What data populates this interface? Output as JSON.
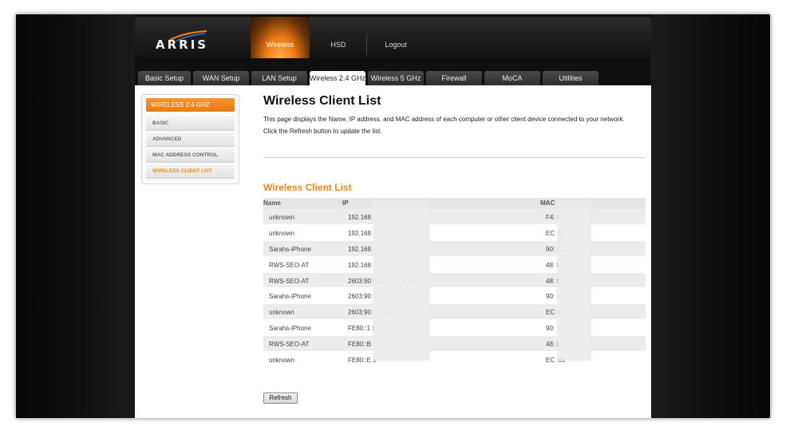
{
  "brand": {
    "logo_text": "ARRIS"
  },
  "nav": [
    {
      "label": "Wireless"
    },
    {
      "label": "HSD"
    },
    {
      "label": "Logout"
    }
  ],
  "tabs": [
    {
      "label": "Basic Setup"
    },
    {
      "label": "WAN Setup"
    },
    {
      "label": "LAN Setup"
    },
    {
      "label": "Wireless 2.4 GHz"
    },
    {
      "label": "Wireless 5 GHz"
    },
    {
      "label": "Firewall"
    },
    {
      "label": "MoCA"
    },
    {
      "label": "Utilities"
    }
  ],
  "sidebar": {
    "header": "WIRELESS 2.4 GHZ",
    "items": [
      {
        "label": "BASIC"
      },
      {
        "label": "ADVANCED"
      },
      {
        "label": "MAC ADDRESS CONTROL"
      },
      {
        "label": "WIRELESS CLIENT LIST"
      }
    ]
  },
  "page": {
    "title": "Wireless Client List",
    "desc1": "This page displays the Name, IP address, and MAC address of each computer or other client device connected to your network.",
    "desc2": "Click the Refresh button to update the list.",
    "subtitle": "Wireless Client List"
  },
  "table": {
    "headers": {
      "name": "Name",
      "ip": "IP",
      "mac": "MAC"
    },
    "rows": [
      {
        "name": "unknown",
        "ip": "192.168",
        "mac": "F4:                     8F"
      },
      {
        "name": "unknown",
        "ip": "192.168",
        "mac": "EC                     :66"
      },
      {
        "name": "Sarahs-iPhone",
        "ip": "192.168",
        "mac": "90:                     :6A"
      },
      {
        "name": "RWS-SEO-AT",
        "ip": "192.168",
        "mac": "48:                     E0"
      },
      {
        "name": "RWS-SEO-AT",
        "ip": "2603:90                                      DA95:E2FE:4527",
        "mac": "48:                     E0"
      },
      {
        "name": "Sarahs-iPhone",
        "ip": "2603:90                                      97CA:30CB:E54A",
        "mac": "90:                     :6A"
      },
      {
        "name": "unknown",
        "ip": "2603:90                                      :C4FF:FE66:4666",
        "mac": "EC                     :66"
      },
      {
        "name": "Sarahs-iPhone",
        "ip": "FE80::1                                      B",
        "mac": "90:                     :6A"
      },
      {
        "name": "RWS-SEO-AT",
        "ip": "FE80::B                                      ",
        "mac": "48:                     E0"
      },
      {
        "name": "unknown",
        "ip": "FE80::E                                      5",
        "mac": "EC                     :66"
      }
    ]
  },
  "actions": {
    "refresh_label": "Refresh"
  },
  "colors": {
    "accent": "#f0861a",
    "frame": "#0a0a0a"
  }
}
